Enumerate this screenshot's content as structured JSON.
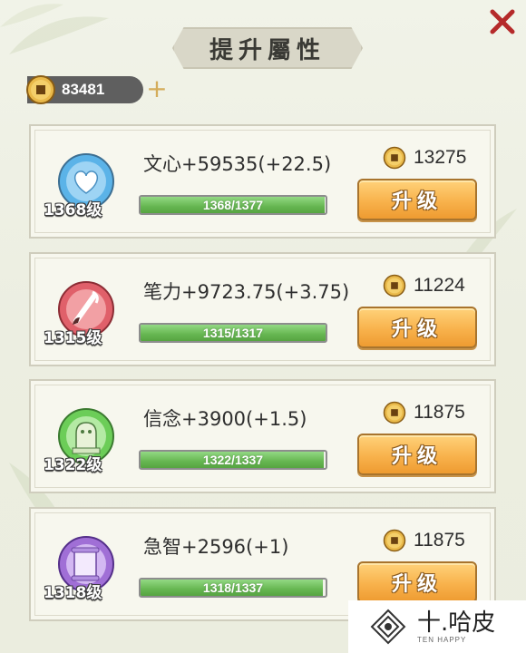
{
  "title": "提升屬性",
  "currency": {
    "icon": "copper-coin-icon",
    "value": "83481",
    "plus_label": "+"
  },
  "close_icon": "close-x-icon",
  "upgrade_label": "升级",
  "attributes": [
    {
      "name": "文心",
      "text": "文心+59535(+22.5)",
      "level": "1368级",
      "progress_label": "1368/1377",
      "current": 1368,
      "max": 1377,
      "cost": "13275",
      "icon": "heart-icon",
      "icon_color": "#5bb3e8"
    },
    {
      "name": "笔力",
      "text": "笔力+9723.75(+3.75)",
      "level": "1315级",
      "progress_label": "1315/1317",
      "current": 1315,
      "max": 1317,
      "cost": "11224",
      "icon": "brush-icon",
      "icon_color": "#e0606a"
    },
    {
      "name": "信念",
      "text": "信念+3900(+1.5)",
      "level": "1322级",
      "progress_label": "1322/1337",
      "current": 1322,
      "max": 1337,
      "cost": "11875",
      "icon": "lion-statue-icon",
      "icon_color": "#6ccd58"
    },
    {
      "name": "急智",
      "text": "急智+2596(+1)",
      "level": "1318级",
      "progress_label": "1318/1337",
      "current": 1318,
      "max": 1337,
      "cost": "11875",
      "icon": "scroll-icon",
      "icon_color": "#a06fd6"
    }
  ],
  "watermark": {
    "cn": "十.哈皮",
    "en": "TEN HAPPY"
  },
  "colors": {
    "accent": "#f8b24c",
    "progress": "#66b651",
    "title_plaque": "#d9d7c8"
  }
}
